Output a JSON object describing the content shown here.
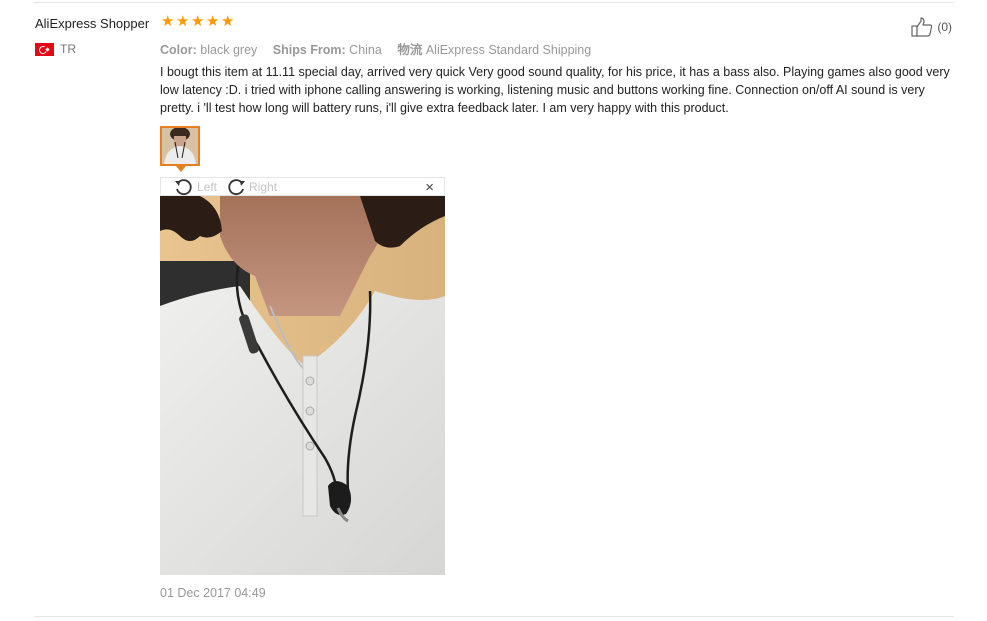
{
  "review": {
    "user_name": "AliExpress Shopper",
    "rating": 5,
    "country_code": "TR",
    "helpful_count": "(0)",
    "attributes": [
      {
        "key": "Color:",
        "value": "black grey"
      },
      {
        "key": "Ships From:",
        "value": "China"
      },
      {
        "key": "物流",
        "value": "AliExpress Standard Shipping"
      }
    ],
    "text": "I bougt this item at 11.11 special day, arrived very quick Very good sound quality, for his price, it has a bass also. Playing games also good very low latency :D. i tried with iphone calling answering is working, listening music and buttons working fine. Connection on/off AI sound is very pretty. i 'll test how long will battery runs, i'll give extra feedback later. I am very happy with this product.",
    "date": "01 Dec 2017 04:49"
  },
  "viewer": {
    "rotate_left_label": "Left",
    "rotate_right_label": "Right",
    "close_label": "×"
  },
  "colors": {
    "star": "#ff9900",
    "thumb_border": "#e67e22",
    "muted_text": "#999999"
  },
  "icons": {
    "star": "star-icon",
    "flag": "turkey-flag-icon",
    "helpful": "thumbs-up-icon",
    "rotate_left": "rotate-left-icon",
    "rotate_right": "rotate-right-icon",
    "close": "close-icon"
  }
}
